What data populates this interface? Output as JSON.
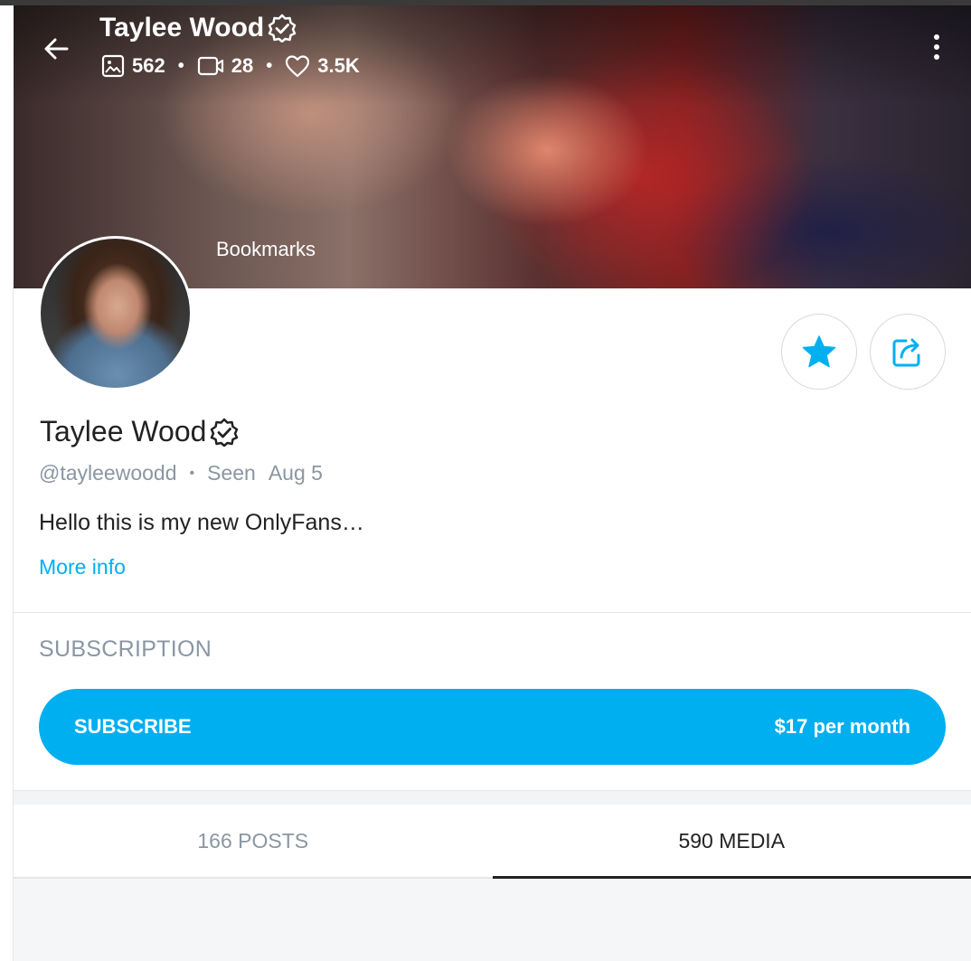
{
  "header": {
    "title": "Taylee Wood",
    "stats": {
      "photos": "562",
      "videos": "28",
      "likes": "3.5K"
    },
    "bookmarks_label": "Bookmarks"
  },
  "profile": {
    "name": "Taylee Wood",
    "handle": "@tayleewoodd",
    "seen_label": "Seen",
    "seen_date": "Aug 5",
    "bio": "Hello this is my new OnlyFans…",
    "more_info_label": "More info"
  },
  "subscription": {
    "heading": "SUBSCRIPTION",
    "button_label": "SUBSCRIBE",
    "price": "$17 per month"
  },
  "tabs": [
    {
      "label": "166 POSTS",
      "active": false
    },
    {
      "label": "590 MEDIA",
      "active": true
    }
  ],
  "colors": {
    "accent": "#00aff0",
    "muted_text": "#8a96a3",
    "primary_text": "#222222"
  },
  "icons": [
    "back-arrow-icon",
    "verified-badge-icon",
    "image-icon",
    "video-icon",
    "heart-icon",
    "more-vertical-icon",
    "star-icon",
    "share-icon"
  ]
}
